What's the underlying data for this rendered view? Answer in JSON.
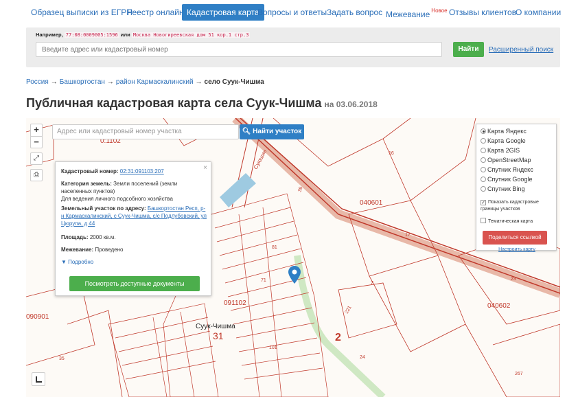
{
  "nav": {
    "items": [
      {
        "label": "Образец выписки из ЕГРН"
      },
      {
        "label": "Реестр онлайн"
      },
      {
        "label": "Кадастровая карта"
      },
      {
        "label": "Вопросы и ответы"
      },
      {
        "label": "Задать вопрос"
      },
      {
        "label": "Межевание"
      },
      {
        "label": "Отзывы клиентов"
      },
      {
        "label": "О компании"
      }
    ],
    "new_badge": "Новое"
  },
  "search": {
    "example_label": "Например,",
    "example_code_1": "77:08:0009005:1596",
    "example_or": "или",
    "example_code_2": "Москва Новогиреевская дом 51 кор.1 стр.3",
    "placeholder": "Введите адрес или кадастровый номер",
    "button": "Найти",
    "advanced": "Расширенный поиск"
  },
  "breadcrumb": {
    "items": [
      "Россия",
      "Башкортостан",
      "район Кармаскалинский"
    ],
    "current": "село Суук-Чишма",
    "separator": "→"
  },
  "page": {
    "title": "Публичная кадастровая карта села Суук-Чишма",
    "date": "на 03.06.2018"
  },
  "map": {
    "zoom_in": "+",
    "zoom_out": "−",
    "search_placeholder": "Адрес или кадастровый номер участка",
    "search_button": "Найти участок",
    "labels": {
      "sector_top": "0:1102",
      "n_040601": "040601",
      "n_040602": "040602",
      "n_090901": "090901",
      "n_091102": "091102",
      "village": "Суук-Чишма",
      "n_31": "31",
      "n_2": "2",
      "road": "Суюшин",
      "p16": "16",
      "p17": "17",
      "p7": "7",
      "p23": "23",
      "p24": "24",
      "p221": "221",
      "p267": "267",
      "p35": "35",
      "p39": "39",
      "p81": "81",
      "p71": "71",
      "p101": "101"
    }
  },
  "popup": {
    "close": "×",
    "cad_label": "Кадастровый номер:",
    "cad_value": "02:31:091103:207",
    "category_label": "Категория земель:",
    "category_value": "Земли поселений (земли населенных пунктов)",
    "usage": "Для ведения личного подсобного хозяйства",
    "address_label": "Земельный участок по адресу:",
    "address_value": "Башкортостан Респ, р-н Кармаскалинский, с Суук-Чишма, с/с Подлубовский, ул Цюрупа, д 44",
    "area_label": "Площадь:",
    "area_value": "2000 кв.м.",
    "survey_label": "Межевание:",
    "survey_value": "Проведено",
    "more": "Подробно",
    "docs_button": "Посмотреть доступные документы"
  },
  "layers": {
    "options": [
      {
        "label": "Карта Яндекс",
        "selected": true
      },
      {
        "label": "Карта Google",
        "selected": false
      },
      {
        "label": "Карта 2GIS",
        "selected": false
      },
      {
        "label": "OpenStreetMap",
        "selected": false
      },
      {
        "label": "Спутник Яндекс",
        "selected": false
      },
      {
        "label": "Спутник Google",
        "selected": false
      },
      {
        "label": "Спутник Bing",
        "selected": false
      }
    ],
    "show_borders": "Показать кадастровые границы участков",
    "thematic": "Тематическая карта",
    "share": "Поделиться ссылкой",
    "setup": "Настроить карту"
  },
  "colors": {
    "accent": "#2f7fc5",
    "green": "#4cae4c",
    "red": "#d9534f",
    "parcel": "#c0392b"
  }
}
